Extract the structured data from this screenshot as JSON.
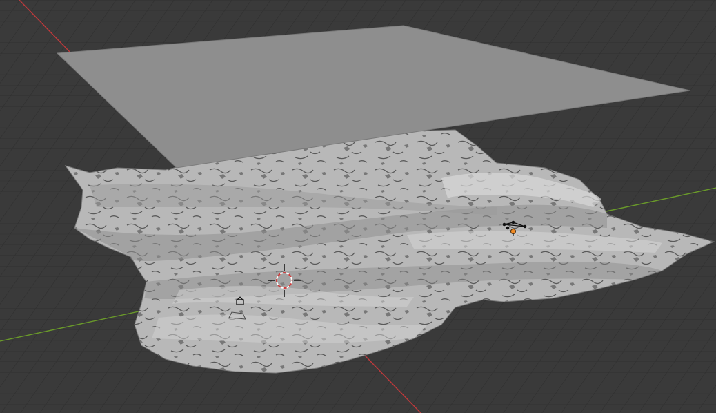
{
  "viewport": {
    "name": "3D Viewport",
    "background_color": "#3a3a3a",
    "grid_color": "#2f2f2f",
    "x_axis_color": "#c0393b",
    "y_axis_color": "#6a9a2a"
  },
  "objects": [
    {
      "name": "plane",
      "type": "mesh",
      "color": "#8e8e8e"
    },
    {
      "name": "terrain",
      "type": "mesh",
      "color": "#bcbcbc"
    },
    {
      "name": "light",
      "type": "light",
      "selected": true,
      "color": "#f08a24"
    },
    {
      "name": "camera",
      "type": "camera"
    }
  ],
  "icons": {
    "cursor": "3d-cursor-icon",
    "light": "light-icon",
    "camera": "camera-icon"
  }
}
